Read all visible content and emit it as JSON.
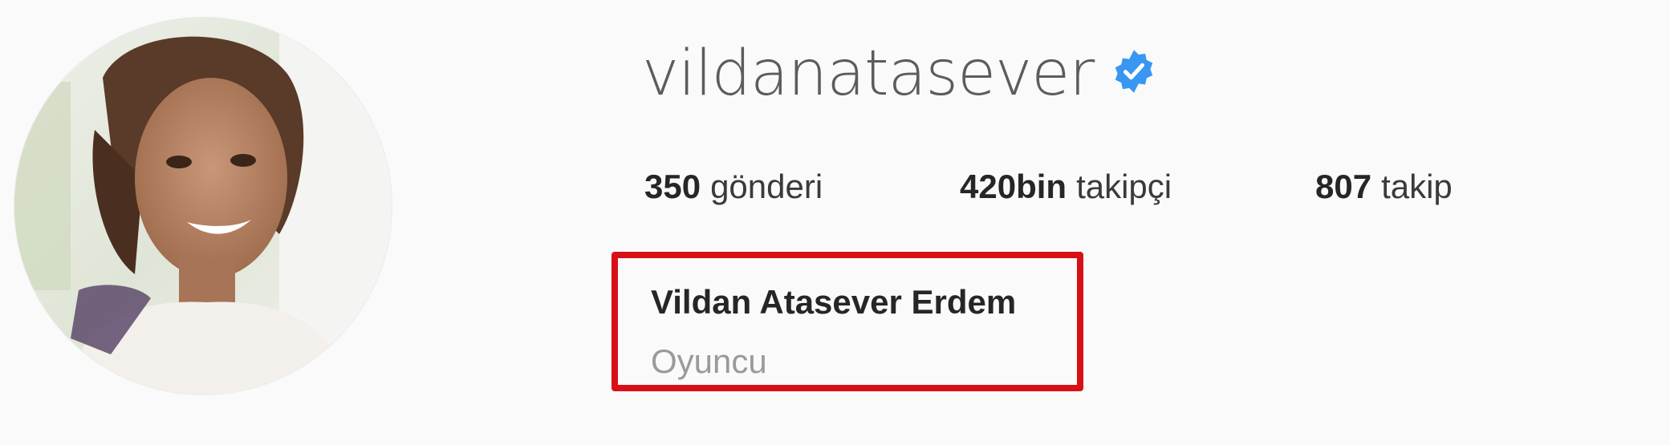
{
  "profile": {
    "username": "vildanatasever",
    "verified": true,
    "avatar_alt": "profile photo",
    "stats": [
      {
        "value": "350",
        "label": "gönderi"
      },
      {
        "value": "420bin",
        "label": "takipçi"
      },
      {
        "value": "807",
        "label": "takip"
      }
    ],
    "full_name": "Vildan Atasever Erdem",
    "category": "Oyuncu"
  },
  "colors": {
    "verified_badge": "#3897f0",
    "highlight_border": "#d80f17",
    "background": "#fafafa"
  },
  "icons": {
    "verified": "verified-badge-icon"
  }
}
